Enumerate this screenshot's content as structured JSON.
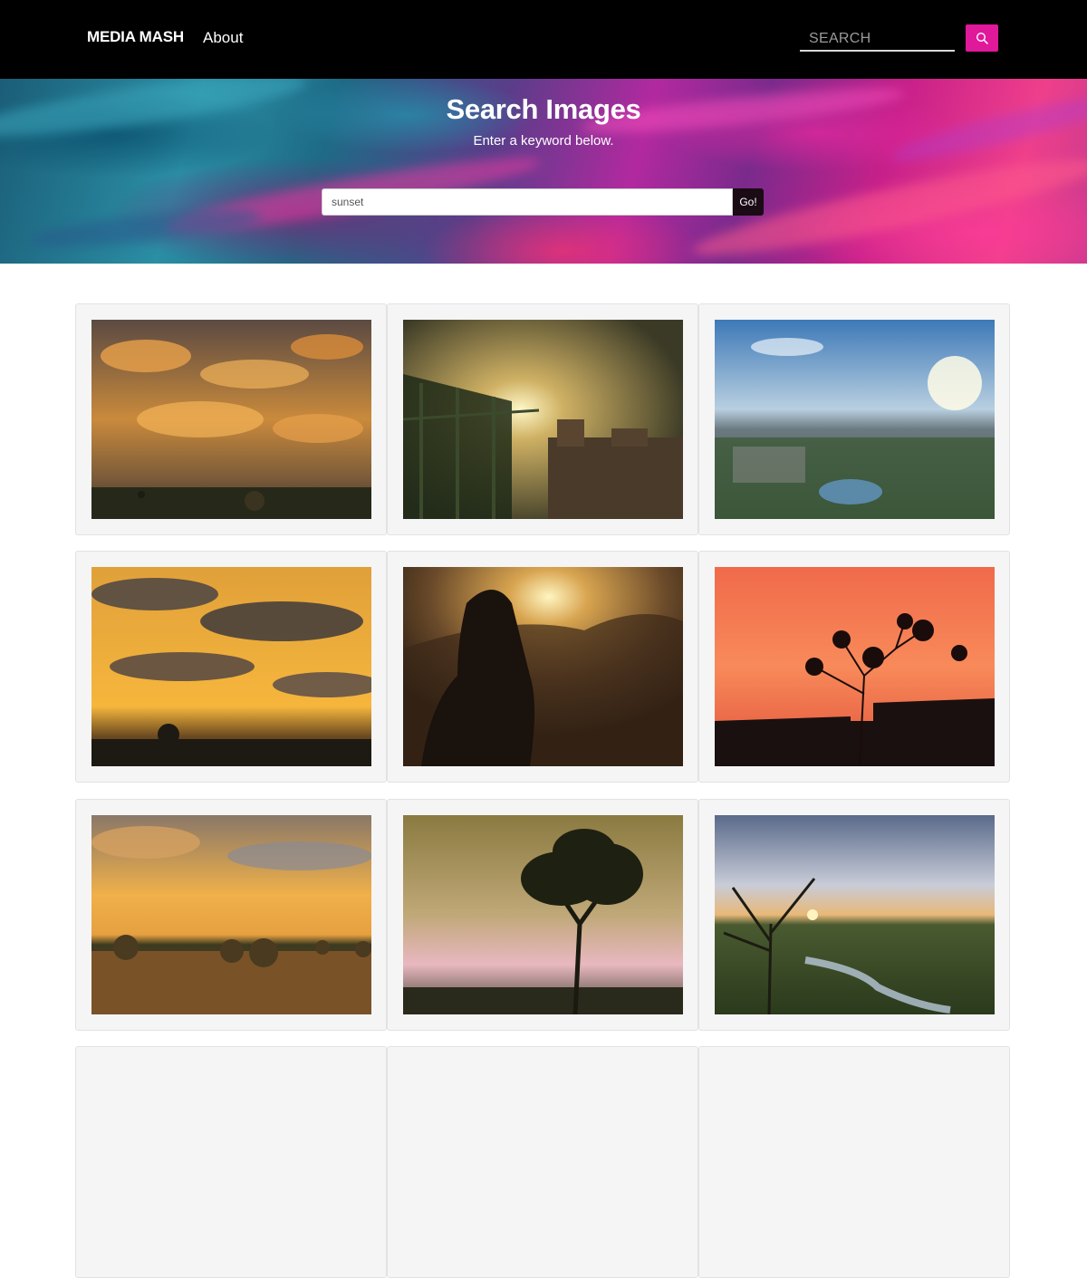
{
  "navbar": {
    "brand": "MEDIA MASH",
    "links": [
      {
        "label": "About"
      }
    ],
    "search_placeholder": "SEARCH",
    "search_button_icon": "search-icon",
    "search_button_color": "#e0189a"
  },
  "hero": {
    "title": "Search Images",
    "subtitle": "Enter a keyword below.",
    "search_value": "sunset",
    "go_label": "Go!"
  },
  "results": [
    {
      "subject": "cloudy sunset over field with hay bales"
    },
    {
      "subject": "sun behind trellis and city rooftops"
    },
    {
      "subject": "aerial view of valley town with sun flare"
    },
    {
      "subject": "golden clouds with sun rays over horizon"
    },
    {
      "subject": "silhouette of person against sunset mountains"
    },
    {
      "subject": "red sky with tree silhouette over rooftops"
    },
    {
      "subject": "hay bales in field under golden clouds"
    },
    {
      "subject": "tree silhouette against pastel sunset"
    },
    {
      "subject": "tree by stream in meadow at sunset"
    }
  ]
}
